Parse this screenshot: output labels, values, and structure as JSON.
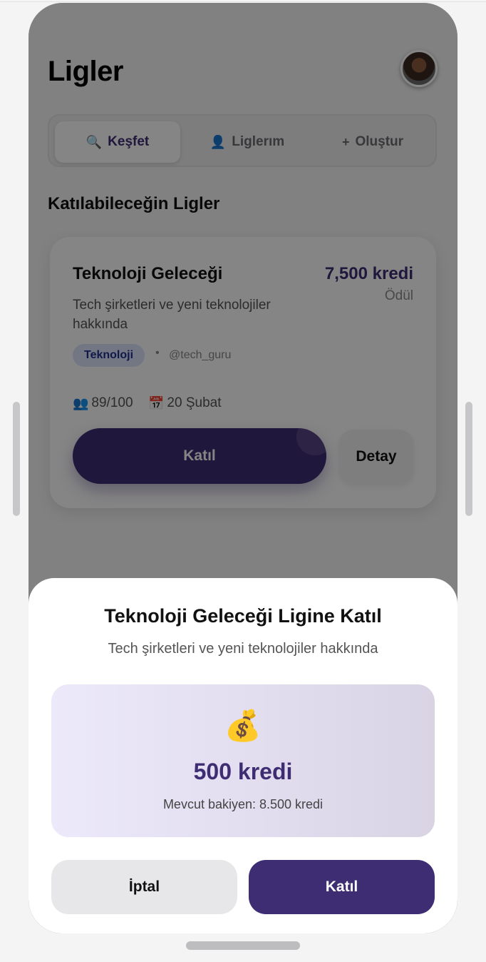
{
  "header": {
    "title": "Ligler"
  },
  "tabs": [
    {
      "label": "Keşfet",
      "icon": "🔍",
      "active": true
    },
    {
      "label": "Liglerım",
      "icon": "👤",
      "active": false
    },
    {
      "label": "Oluştur",
      "icon": "+",
      "active": false
    }
  ],
  "section": {
    "title": "Katılabileceğin Ligler"
  },
  "league_card": {
    "name": "Teknoloji Geleceği",
    "prize": "7,500 kredi",
    "prize_label": "Ödül",
    "description": "Tech şirketleri ve yeni teknolojiler hakkında",
    "tag": "Teknoloji",
    "separator": "•",
    "author": "@tech_guru",
    "participants_icon": "👥",
    "participants": "89/100",
    "date_icon": "📅",
    "date": "20 Şubat",
    "join_label": "Katıl",
    "detail_label": "Detay"
  },
  "modal": {
    "title": "Teknoloji Geleceği Ligine Katıl",
    "description": "Tech şirketleri ve yeni teknolojiler hakkında",
    "money_icon": "💰",
    "cost": "500 kredi",
    "balance": "Mevcut bakiyen: 8.500 kredi",
    "cancel_label": "İptal",
    "confirm_label": "Katıl"
  },
  "colors": {
    "accent": "#3f2d73",
    "tag_bg": "#dde4fb",
    "tag_text": "#22318f"
  }
}
